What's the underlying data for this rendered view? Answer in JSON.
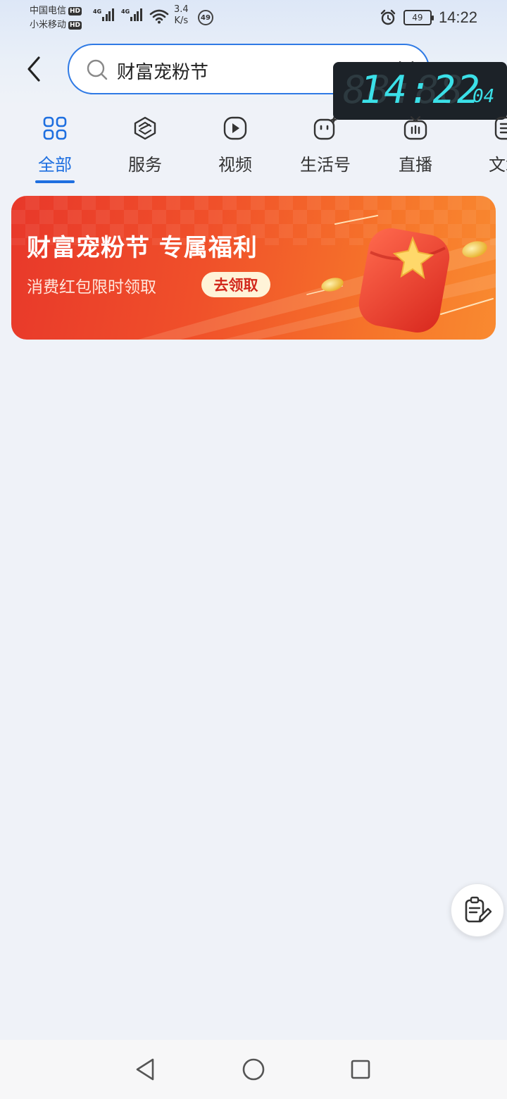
{
  "status_bar": {
    "carrier1": "中国电信",
    "carrier2": "小米移动",
    "hd_badge": "HD",
    "network_type": "4G",
    "speed_value": "3.4",
    "speed_unit": "K/s",
    "notification_count": "49",
    "battery_level": "49",
    "time": "14:22"
  },
  "search": {
    "query": "财富宠粉节",
    "back_icon": "chevron-left-icon",
    "search_icon": "search-icon",
    "clear_icon": "close-icon",
    "more_icon": "more-dots-icon"
  },
  "clock_overlay": {
    "time": "14:22",
    "seconds": "04"
  },
  "tabs": [
    {
      "label": "全部",
      "icon": "grid-icon",
      "active": true
    },
    {
      "label": "服务",
      "icon": "cube-icon",
      "active": false
    },
    {
      "label": "视频",
      "icon": "play-icon",
      "active": false
    },
    {
      "label": "生活号",
      "icon": "face-icon",
      "active": false
    },
    {
      "label": "直播",
      "icon": "tv-icon",
      "active": false
    },
    {
      "label": "文章",
      "icon": "document-icon",
      "active": false
    }
  ],
  "banner": {
    "title": "财富宠粉节 专属福利",
    "subtitle": "消费红包限时领取",
    "button_label": "去领取",
    "colors": {
      "start": "#e8382a",
      "end": "#f98a30"
    }
  },
  "fab": {
    "icon": "edit-note-icon"
  },
  "nav_bar": {
    "back": "nav-back-icon",
    "home": "nav-home-icon",
    "recents": "nav-recents-icon"
  },
  "colors": {
    "accent": "#1e6fe0",
    "background": "#eff2f8"
  }
}
